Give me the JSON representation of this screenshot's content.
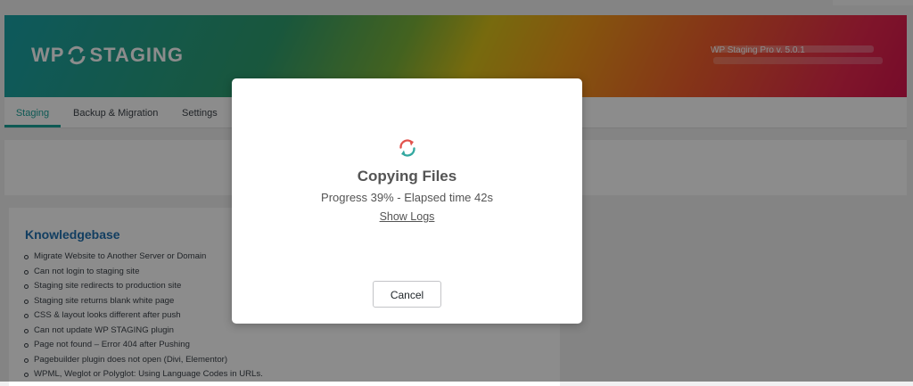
{
  "header": {
    "logo_left": "WP",
    "logo_right": "STAGING",
    "version": "WP Staging Pro v. 5.0.1"
  },
  "tabs": [
    {
      "label": "Staging",
      "active": true
    },
    {
      "label": "Backup & Migration",
      "active": false
    },
    {
      "label": "Settings",
      "active": false
    }
  ],
  "knowledgebase": {
    "title": "Knowledgebase",
    "items": [
      "Migrate Website to Another Server or Domain",
      "Can not login to staging site",
      "Staging site redirects to production site",
      "Staging site returns blank white page",
      "CSS & layout looks different after push",
      "Can not update WP STAGING plugin",
      "Page not found – Error 404 after Pushing",
      "Pagebuilder plugin does not open (Divi, Elementor)",
      "WPML, Weglot or Polyglot: Using Language Codes in URLs."
    ]
  },
  "modal": {
    "icon": "sync-icon",
    "title": "Copying Files",
    "progress_text": "Progress 39% - Elapsed time 42s",
    "progress_percent": 39,
    "show_logs_label": "Show Logs",
    "cancel_label": "Cancel"
  },
  "colors": {
    "accent": "#1aa39a",
    "link": "#2271b1",
    "icon_red": "#e2534d",
    "icon_teal": "#33a8a0"
  }
}
